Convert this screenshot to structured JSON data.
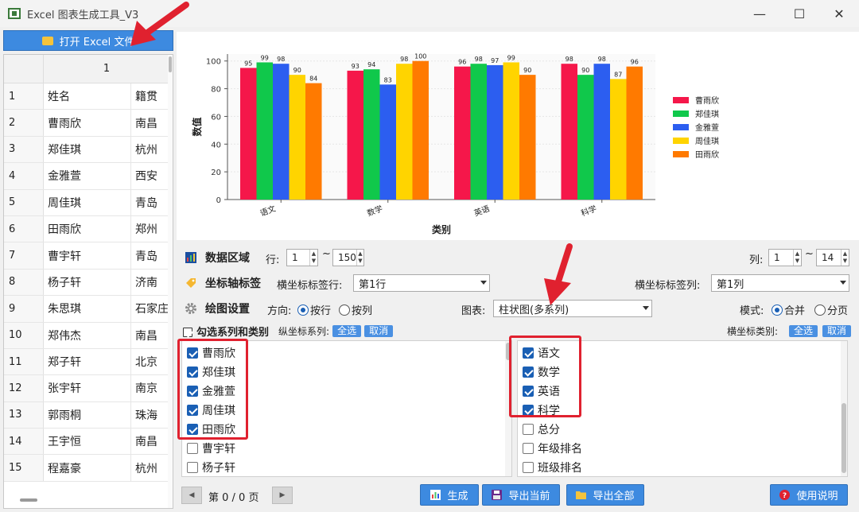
{
  "window": {
    "title": "Excel 图表生成工具_V3",
    "controls": [
      "—",
      "☐",
      "✕"
    ]
  },
  "left": {
    "open_button_label": "打开 Excel 文件",
    "column_header": "1",
    "rows": [
      {
        "n": "1",
        "name": "姓名",
        "city": "籍贯"
      },
      {
        "n": "2",
        "name": "曹雨欣",
        "city": "南昌"
      },
      {
        "n": "3",
        "name": "郑佳琪",
        "city": "杭州"
      },
      {
        "n": "4",
        "name": "金雅萱",
        "city": "西安"
      },
      {
        "n": "5",
        "name": "周佳琪",
        "city": "青岛"
      },
      {
        "n": "6",
        "name": "田雨欣",
        "city": "郑州"
      },
      {
        "n": "7",
        "name": "曹宇轩",
        "city": "青岛"
      },
      {
        "n": "8",
        "name": "杨子轩",
        "city": "济南"
      },
      {
        "n": "9",
        "name": "朱思琪",
        "city": "石家庄"
      },
      {
        "n": "10",
        "name": "郑伟杰",
        "city": "南昌"
      },
      {
        "n": "11",
        "name": "郑子轩",
        "city": "北京"
      },
      {
        "n": "12",
        "name": "张宇轩",
        "city": "南京"
      },
      {
        "n": "13",
        "name": "郭雨桐",
        "city": "珠海"
      },
      {
        "n": "14",
        "name": "王宇恒",
        "city": "南昌"
      },
      {
        "n": "15",
        "name": "程嘉豪",
        "city": "杭州"
      }
    ]
  },
  "chart_data": {
    "type": "bar",
    "xlabel": "类别",
    "ylabel": "数值",
    "ylim": [
      0,
      105
    ],
    "yticks": [
      0,
      20,
      40,
      60,
      80,
      100
    ],
    "categories": [
      "语文",
      "数学",
      "英语",
      "科学"
    ],
    "legend_position": "right",
    "series": [
      {
        "name": "曹雨欣",
        "color": "#f5174a",
        "values": [
          95,
          93,
          96,
          98
        ]
      },
      {
        "name": "郑佳琪",
        "color": "#10c84b",
        "values": [
          99,
          94,
          98,
          90
        ]
      },
      {
        "name": "金雅萱",
        "color": "#2c5ef0",
        "values": [
          98,
          83,
          97,
          98
        ]
      },
      {
        "name": "周佳琪",
        "color": "#ffd400",
        "values": [
          90,
          98,
          99,
          87
        ]
      },
      {
        "name": "田雨欣",
        "color": "#ff7a00",
        "values": [
          84,
          100,
          90,
          96
        ]
      }
    ]
  },
  "data_range": {
    "title": "数据区域",
    "row_label": "行:",
    "row_from": "1",
    "row_to": "150",
    "tilde": "~",
    "col_label": "列:",
    "col_from": "1",
    "col_to": "14"
  },
  "axis_labels": {
    "title": "坐标轴标签",
    "x_row_label": "横坐标标签行:",
    "x_row_value": "第1行",
    "x_col_label": "横坐标标签列:",
    "x_col_value": "第1列"
  },
  "plot_settings": {
    "title": "绘图设置",
    "direction_label": "方向:",
    "by_row": "按行",
    "by_col": "按列",
    "chart_label": "图表:",
    "chart_value": "柱状图(多系列)",
    "mode_label": "模式:",
    "merge": "合并",
    "paged": "分页"
  },
  "selector": {
    "title": "勾选系列和类别",
    "series_label": "纵坐标系列:",
    "select_all": "全选",
    "cancel": "取消",
    "category_label": "横坐标类别:",
    "series_items": [
      {
        "label": "曹雨欣",
        "checked": true
      },
      {
        "label": "郑佳琪",
        "checked": true
      },
      {
        "label": "金雅萱",
        "checked": true
      },
      {
        "label": "周佳琪",
        "checked": true
      },
      {
        "label": "田雨欣",
        "checked": true
      },
      {
        "label": "曹宇轩",
        "checked": false
      },
      {
        "label": "杨子轩",
        "checked": false
      }
    ],
    "category_items": [
      {
        "label": "语文",
        "checked": true
      },
      {
        "label": "数学",
        "checked": true
      },
      {
        "label": "英语",
        "checked": true
      },
      {
        "label": "科学",
        "checked": true
      },
      {
        "label": "总分",
        "checked": false
      },
      {
        "label": "年级排名",
        "checked": false
      },
      {
        "label": "班级排名",
        "checked": false
      }
    ]
  },
  "bottom": {
    "prev": "◀",
    "next": "▶",
    "page_text": "第 0 / 0 页",
    "generate": "生成",
    "export_current": "导出当前",
    "export_all": "导出全部",
    "help": "使用说明"
  },
  "colors": {
    "accent": "#3d8ae0",
    "highlight": "#e0212f"
  }
}
